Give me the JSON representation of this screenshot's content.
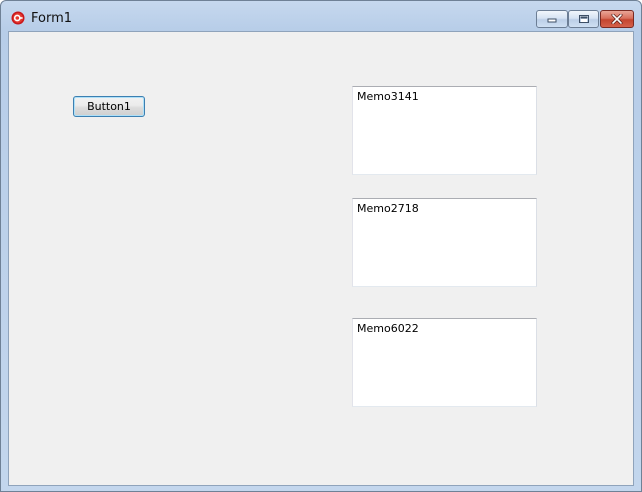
{
  "window": {
    "title": "Form1",
    "icon": "app-icon",
    "controls": [
      "minimize-icon",
      "maximize-icon",
      "close-icon"
    ]
  },
  "form": {
    "button1_label": "Button1",
    "memos": [
      "Memo3141",
      "Memo2718",
      "Memo6022"
    ]
  }
}
